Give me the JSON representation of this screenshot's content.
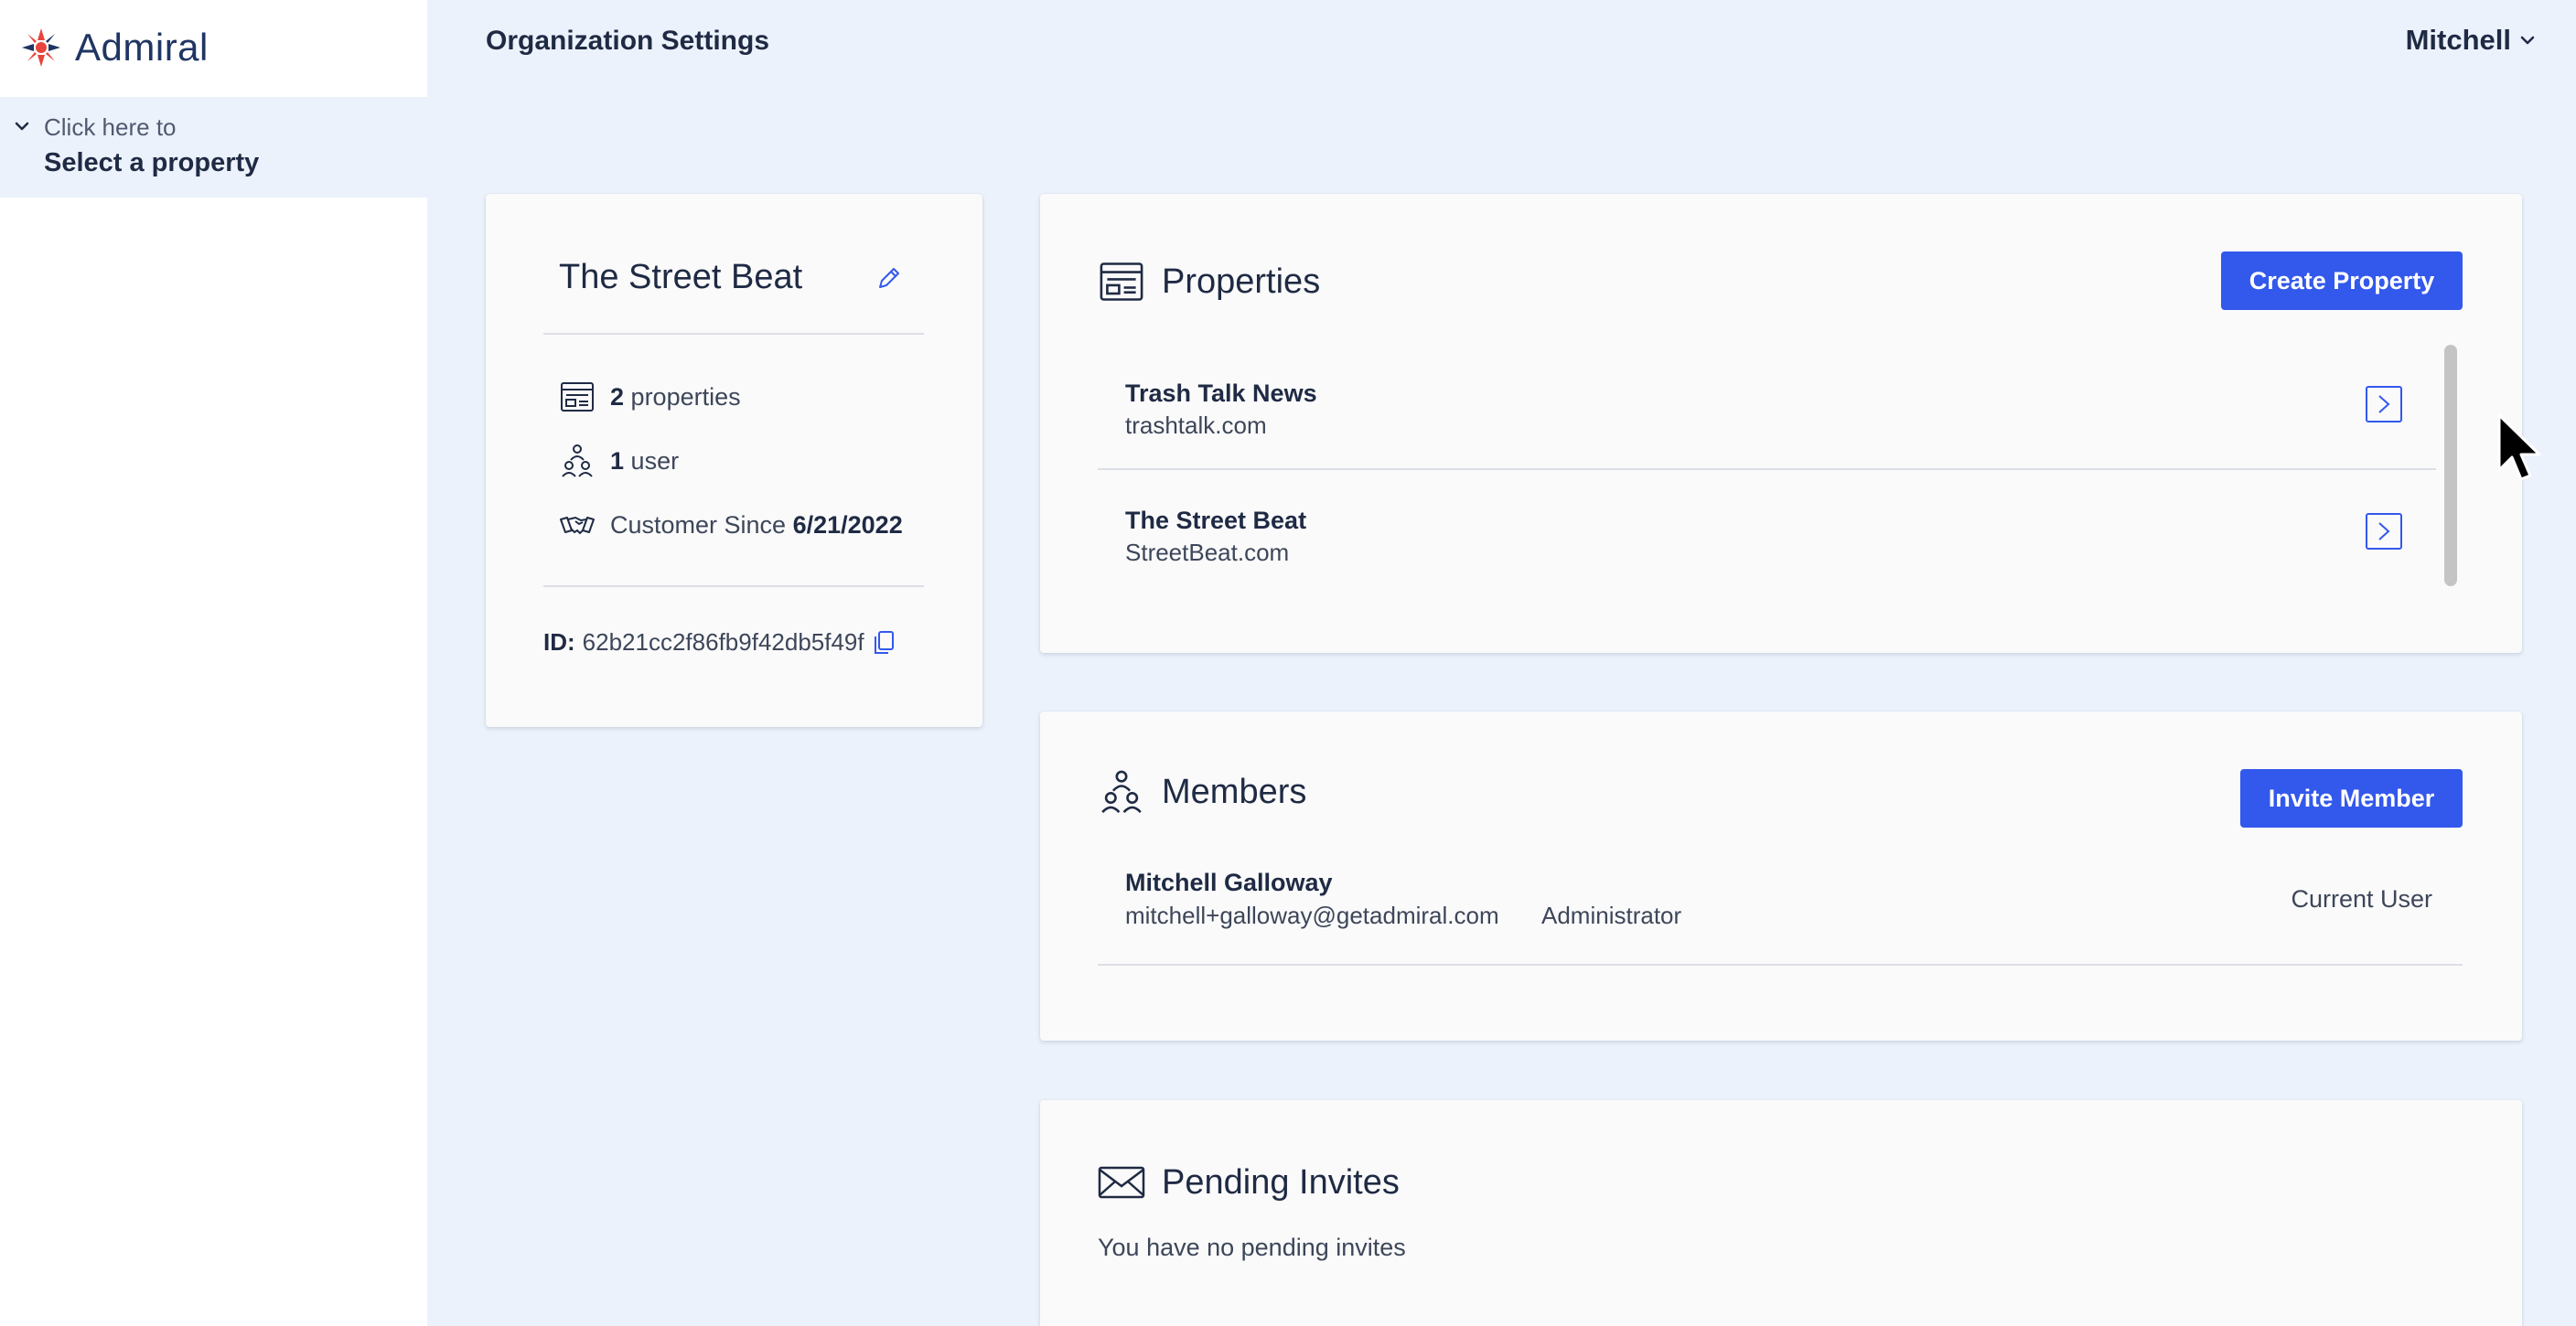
{
  "app": {
    "logo_text": "Admiral",
    "accent_color": "#3358ec",
    "logo_color_red": "#e8453c"
  },
  "sidebar": {
    "property_selector": {
      "hint": "Click here to",
      "label": "Select a property"
    }
  },
  "header": {
    "title": "Organization Settings",
    "user_name": "Mitchell"
  },
  "organization": {
    "name": "The Street Beat",
    "properties_count": "2",
    "properties_label": "properties",
    "users_count": "1",
    "users_label": "user",
    "customer_since_label": "Customer Since",
    "customer_since_date": "6/21/2022",
    "id_label": "ID:",
    "id_value": "62b21cc2f86fb9f42db5f49f"
  },
  "properties_section": {
    "title": "Properties",
    "create_button": "Create Property",
    "items": [
      {
        "name": "Trash Talk News",
        "domain": "trashtalk.com"
      },
      {
        "name": "The Street Beat",
        "domain": "StreetBeat.com"
      }
    ]
  },
  "members_section": {
    "title": "Members",
    "invite_button": "Invite Member",
    "members": [
      {
        "name": "Mitchell Galloway",
        "email": "mitchell+galloway@getadmiral.com",
        "role": "Administrator",
        "status": "Current User"
      }
    ]
  },
  "invites_section": {
    "title": "Pending Invites",
    "empty_text": "You have no pending invites"
  }
}
